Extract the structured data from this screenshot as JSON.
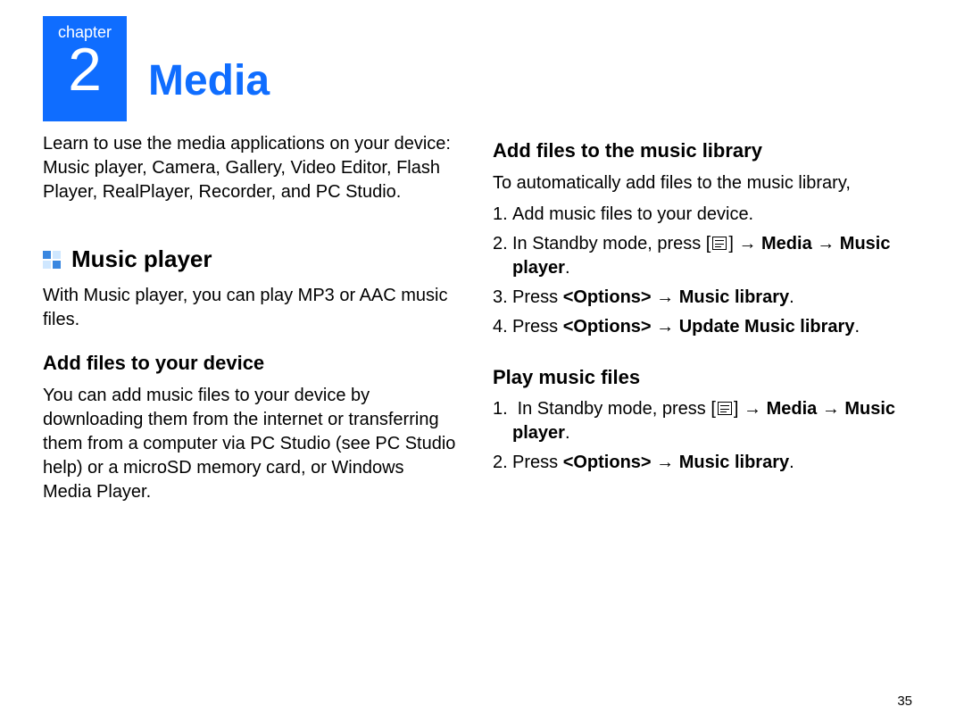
{
  "chapter": {
    "label": "chapter",
    "number": "2",
    "title": "Media"
  },
  "intro": "Learn to use the media applications on your device: Music player, Camera, Gallery, Video Editor, Flash Player, RealPlayer, Recorder, and PC Studio.",
  "section": {
    "title": "Music player",
    "desc": "With Music player, you can play MP3 or AAC music files."
  },
  "sub1": {
    "title": "Add files to your device",
    "body": "You can add music files to your device by downloading them from the internet or transferring them from a computer via PC Studio (see PC Studio help) or a microSD memory card, or Windows Media Player."
  },
  "sub2": {
    "title": "Add files to the music library",
    "intro": "To automatically add files to the music library,",
    "s1": "Add music files to your device.",
    "s2a": "In Standby mode, press [",
    "s2b": "] → ",
    "s2c": "Media → Music player",
    "s3a": "Press ",
    "s3b": "<Options>",
    "s3c": " → ",
    "s3d": "Music library",
    "s4a": "Press ",
    "s4b": "<Options>",
    "s4c": " → ",
    "s4d": "Update Music library"
  },
  "sub3": {
    "title": "Play music files",
    "s1a": "In Standby mode, press [",
    "s1b": "] → ",
    "s1c": "Media → Music player",
    "s2a": "Press ",
    "s2b": "<Options>",
    "s2c": " → ",
    "s2d": "Music library"
  },
  "page_number": "35"
}
